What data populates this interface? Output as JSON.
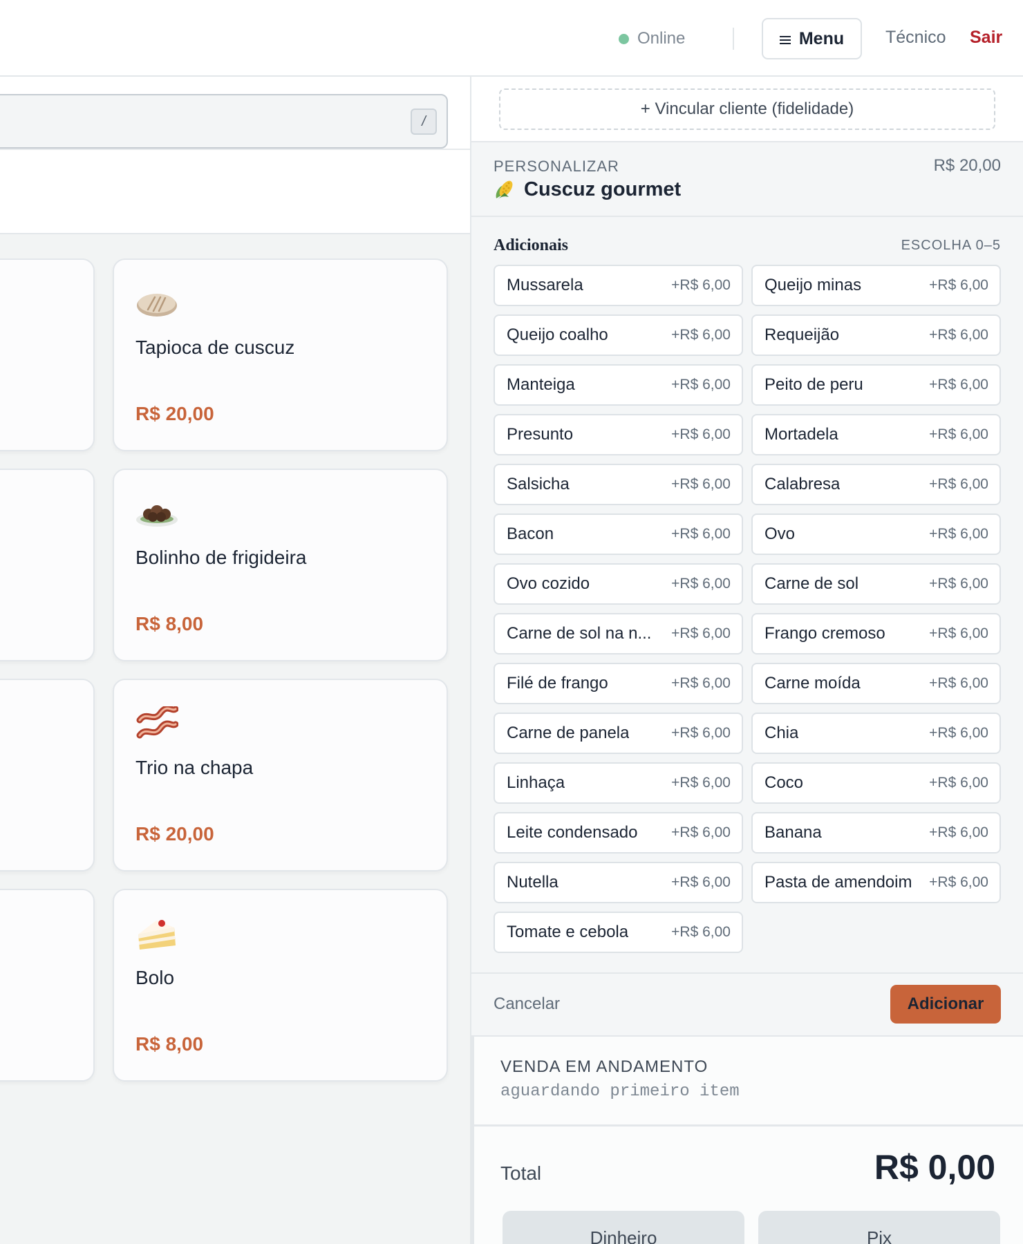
{
  "topbar": {
    "status": "Online",
    "menu_label": "Menu",
    "user_label": "Técnico",
    "logout_label": "Sair"
  },
  "search": {
    "shortcut_key": "/"
  },
  "products": [
    {
      "name": "Tapioca de cuscuz",
      "price": "R$ 20,00",
      "icon": "flatbread-icon"
    },
    {
      "name": "Bolinho de frigideira",
      "price": "R$ 8,00",
      "icon": "fritters-plate-icon"
    },
    {
      "name": "Trio na chapa",
      "price": "R$ 20,00",
      "icon": "bacon-icon"
    },
    {
      "name": "Bolo",
      "price": "R$ 8,00",
      "icon": "cake-slice-icon"
    }
  ],
  "customer": {
    "link_label": "+ Vincular cliente (fidelidade)"
  },
  "customize": {
    "kicker": "PERSONALIZAR",
    "price": "R$ 20,00",
    "item_name": "Cuscuz gourmet",
    "item_icon": "corn-icon",
    "group_title": "Adicionais",
    "group_rule": "ESCOLHA 0–5",
    "options": [
      {
        "name": "Mussarela",
        "price": "+R$ 6,00"
      },
      {
        "name": "Queijo minas",
        "price": "+R$ 6,00"
      },
      {
        "name": "Queijo coalho",
        "price": "+R$ 6,00"
      },
      {
        "name": "Requeijão",
        "price": "+R$ 6,00"
      },
      {
        "name": "Manteiga",
        "price": "+R$ 6,00"
      },
      {
        "name": "Peito de peru",
        "price": "+R$ 6,00"
      },
      {
        "name": "Presunto",
        "price": "+R$ 6,00"
      },
      {
        "name": "Mortadela",
        "price": "+R$ 6,00"
      },
      {
        "name": "Salsicha",
        "price": "+R$ 6,00"
      },
      {
        "name": "Calabresa",
        "price": "+R$ 6,00"
      },
      {
        "name": "Bacon",
        "price": "+R$ 6,00"
      },
      {
        "name": "Ovo",
        "price": "+R$ 6,00"
      },
      {
        "name": "Ovo cozido",
        "price": "+R$ 6,00"
      },
      {
        "name": "Carne de sol",
        "price": "+R$ 6,00"
      },
      {
        "name": "Carne de sol na n...",
        "price": "+R$ 6,00"
      },
      {
        "name": "Frango cremoso",
        "price": "+R$ 6,00"
      },
      {
        "name": "Filé de frango",
        "price": "+R$ 6,00"
      },
      {
        "name": "Carne moída",
        "price": "+R$ 6,00"
      },
      {
        "name": "Carne de panela",
        "price": "+R$ 6,00"
      },
      {
        "name": "Chia",
        "price": "+R$ 6,00"
      },
      {
        "name": "Linhaça",
        "price": "+R$ 6,00"
      },
      {
        "name": "Coco",
        "price": "+R$ 6,00"
      },
      {
        "name": "Leite condensado",
        "price": "+R$ 6,00"
      },
      {
        "name": "Banana",
        "price": "+R$ 6,00"
      },
      {
        "name": "Nutella",
        "price": "+R$ 6,00"
      },
      {
        "name": "Pasta de amendoim",
        "price": "+R$ 6,00"
      },
      {
        "name": "Tomate e cebola",
        "price": "+R$ 6,00"
      }
    ],
    "cancel_label": "Cancelar",
    "add_label": "Adicionar"
  },
  "sale": {
    "kicker": "VENDA EM ANDAMENTO",
    "status": "aguardando primeiro item",
    "total_label": "Total",
    "total_value": "R$ 0,00",
    "pay_cash_label": "Dinheiro",
    "pay_pix_label": "Pix"
  },
  "colors": {
    "accent": "#c8643a",
    "logout": "#b5212a",
    "online_dot": "#7cc6a0"
  }
}
